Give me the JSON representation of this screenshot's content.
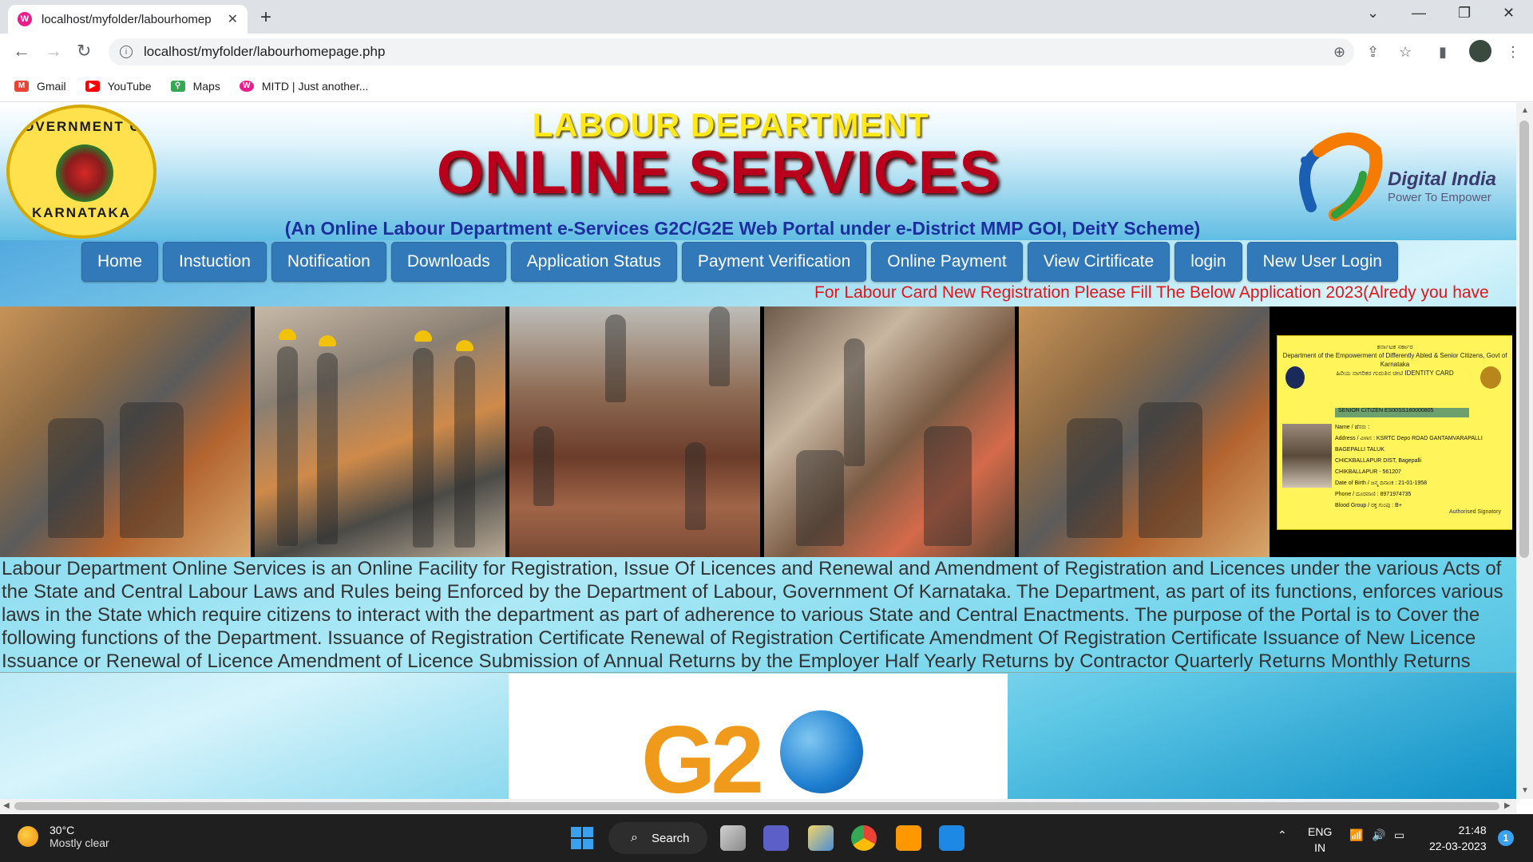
{
  "browser": {
    "tab_title": "localhost/myfolder/labourhomep",
    "tab_favicon": "W",
    "url": "localhost/myfolder/labourhomepage.php",
    "bookmarks": [
      {
        "label": "Gmail",
        "icon": "gmail-icon",
        "color": "#ea4335",
        "glyph": "M"
      },
      {
        "label": "YouTube",
        "icon": "youtube-icon",
        "color": "#ff0000",
        "glyph": "▶"
      },
      {
        "label": "Maps",
        "icon": "maps-icon",
        "color": "#34a853",
        "glyph": "⚲"
      },
      {
        "label": "MITD | Just another...",
        "icon": "mitd-icon",
        "color": "#e91e8c",
        "glyph": "W"
      }
    ]
  },
  "header": {
    "line1": "LABOUR DEPARTMENT",
    "line2": "ONLINE SERVICES",
    "line3": "(An Online Labour Department e-Services G2C/G2E Web Portal under e-District MMP GOI, DeitY Scheme)",
    "seal_top": "GOVERNMENT OF",
    "seal_bottom": "KARNATAKA",
    "di_title": "Digital India",
    "di_tagline": "Power To Empower"
  },
  "nav": [
    {
      "label": "Home"
    },
    {
      "label": "Instuction"
    },
    {
      "label": "Notification"
    },
    {
      "label": "Downloads"
    },
    {
      "label": "Application Status"
    },
    {
      "label": "Payment Verification"
    },
    {
      "label": "Online Payment"
    },
    {
      "label": "View Cirtificate"
    },
    {
      "label": "login"
    },
    {
      "label": "New User Login"
    }
  ],
  "marquee": "For Labour Card New Registration Please Fill The Below Application 2023(Alredy you have",
  "id_card": {
    "header": "ಕರ್ನಾಟಕ ಸರ್ಕಾರ",
    "header2": "Department of the Empowerment of Differently Abled & Senior Citizens, Govt of Karnataka",
    "card_title": "ಹಿರಿಯ ನಾಗರಿಕರ ಗುರುತಿನ ಚೀಟಿ IDENTITY CARD",
    "tag": "SENIOR CITIZEN  ES00SS180000805",
    "fields": "Name / ಹೆಸರು :\nAddress / ವಿಳಾಸ : KSRTC Depo ROAD GANTAMVARAPALLI\nBAGEPALLI TALUK\nCHICKBALLAPUR DIST, Bagepalli\nCHIKBALLAPUR - 561207\nDate of Birth / ಜನ್ಮ ದಿನಾಂಕ : 21-01-1958\nPhone / ದೂರವಾಣಿ : 8971974735\nBlood Group / ರಕ್ತ ಗುಂಪು : B+",
    "signatory": "Authorised Signatory"
  },
  "description": "Labour Department Online Services is an Online Facility for Registration, Issue Of Licences and Renewal and Amendment of Registration and Licences under the various Acts of the State and Central Labour Laws and Rules being Enforced by the Department of Labour, Government Of Karnataka. The Department, as part of its functions, enforces various laws in the State which require citizens to interact with the department as part of adherence to various State and Central Enactments. The purpose of the Portal is to Cover the following functions of the Department. Issuance of Registration Certificate Renewal of Registration Certificate Amendment Of Registration Certificate Issuance of New Licence Issuance or Renewal of Licence Amendment of Licence Submission of Annual Returns by the Employer Half Yearly Returns by Contractor Quarterly Returns Monthly Returns",
  "g20_text": "G2",
  "taskbar": {
    "weather_temp": "30°C",
    "weather_desc": "Mostly clear",
    "search_label": "Search",
    "lang": "ENG",
    "region": "IN",
    "time": "21:48",
    "date": "22-03-2023",
    "notif_count": "1"
  }
}
